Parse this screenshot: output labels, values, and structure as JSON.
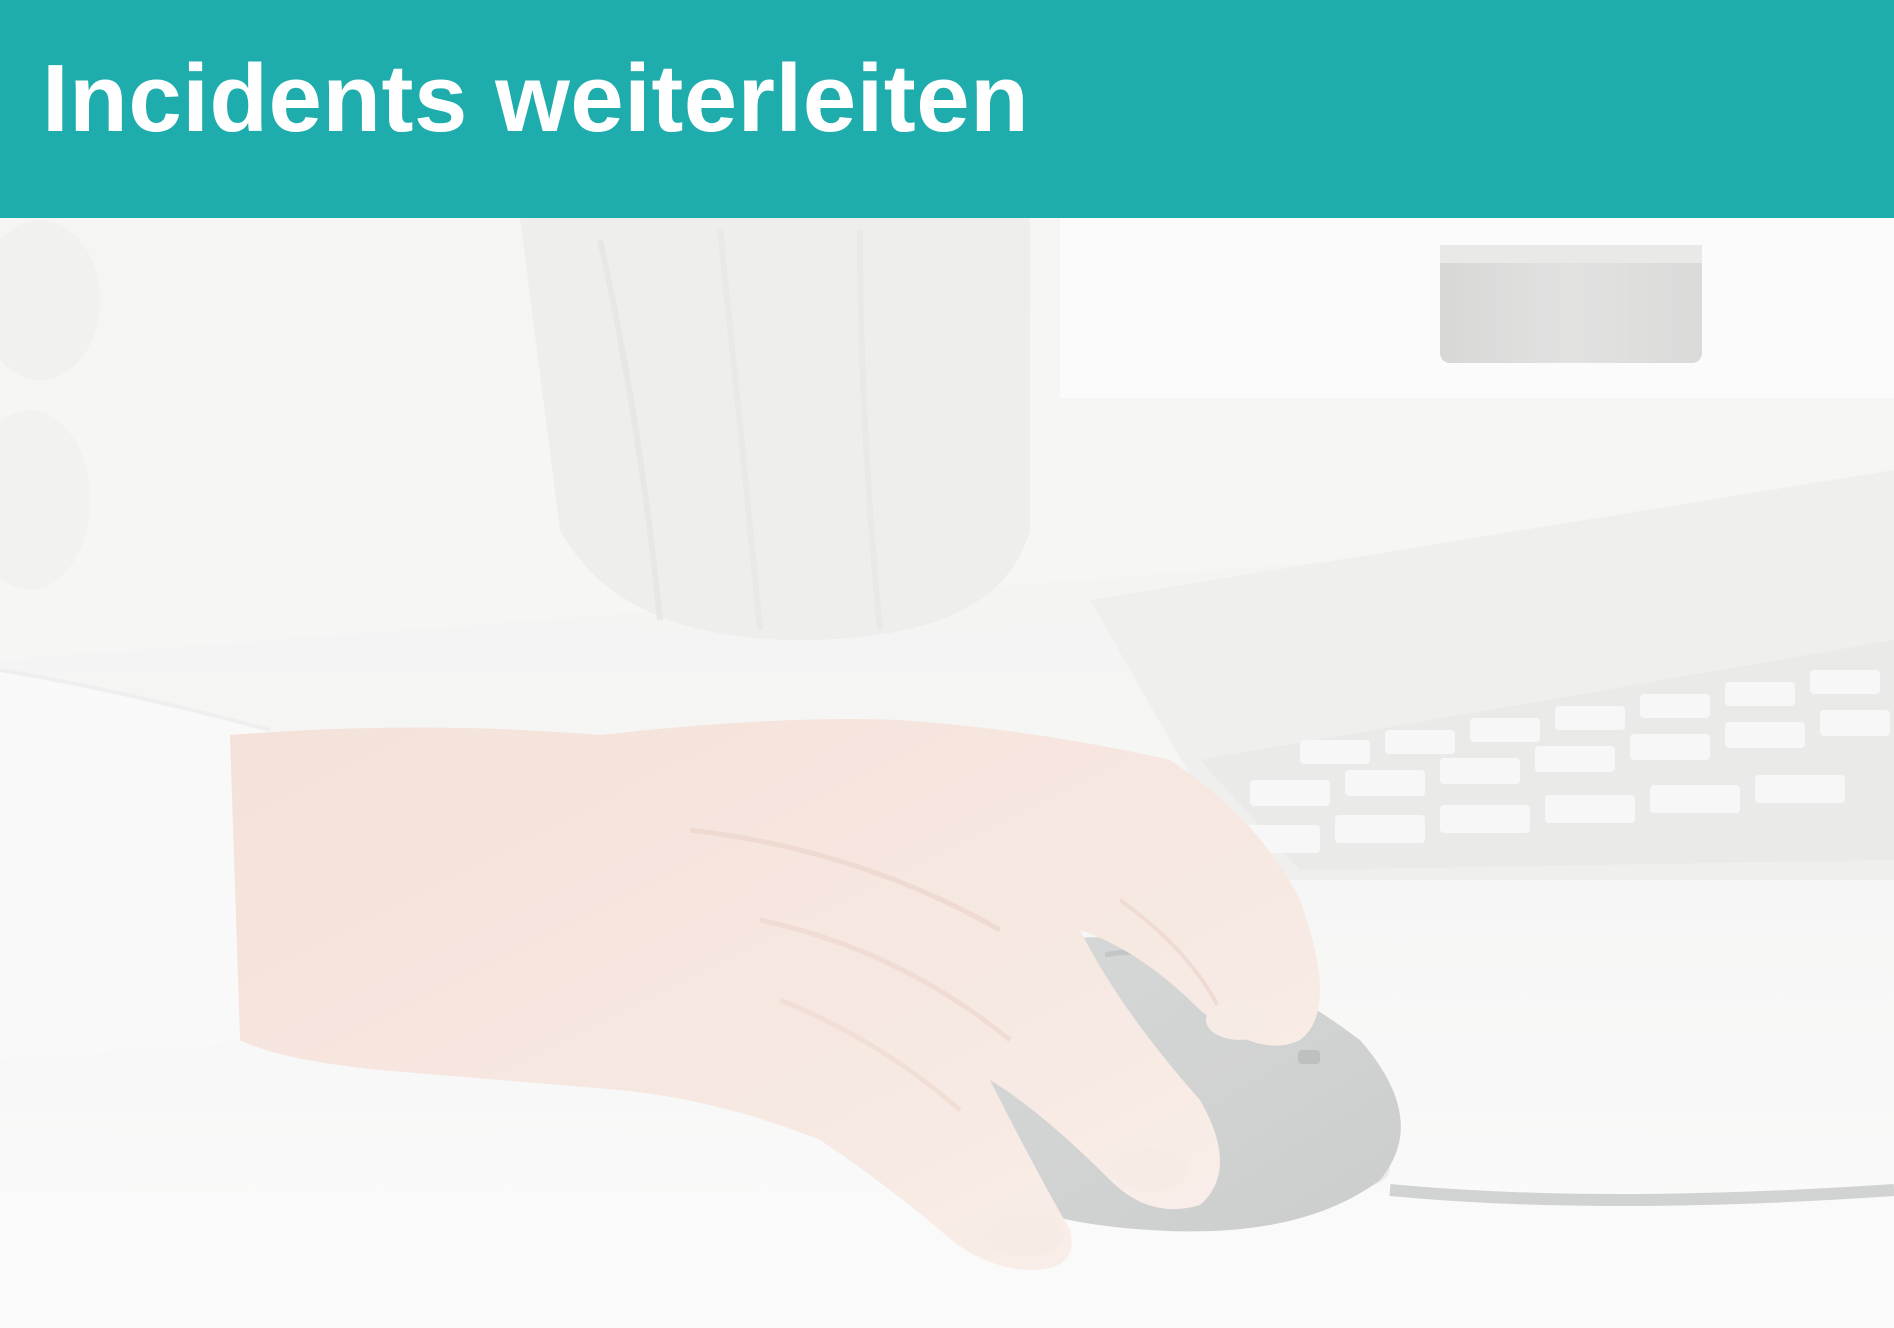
{
  "header": {
    "title": "Incidents weiterleiten",
    "background_color": "#1eadac",
    "text_color": "#ffffff"
  },
  "hero": {
    "background_color": "#f4f4f3",
    "icons": [
      "hand-icon",
      "computer-mouse-icon",
      "keyboard-icon",
      "cup-icon",
      "vase-icon"
    ]
  }
}
